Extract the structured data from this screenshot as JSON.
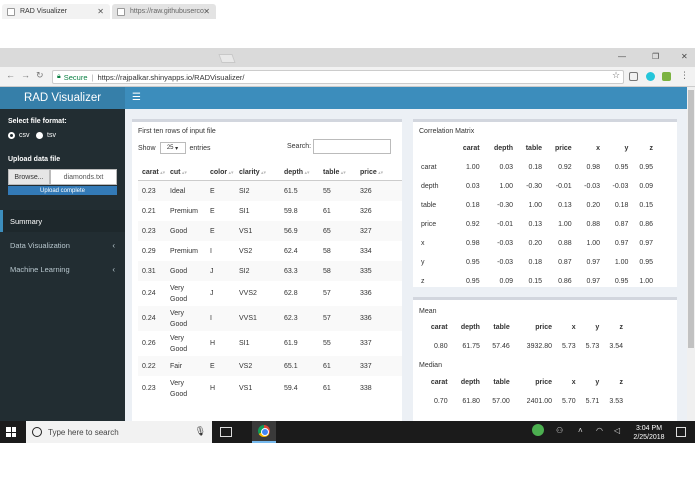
{
  "browser": {
    "tabs": [
      {
        "title": "RAD Visualizer",
        "active": true
      },
      {
        "title": "https://raw.githubuserco",
        "active": false
      }
    ],
    "secure_label": "Secure",
    "url": "https://rajpalkar.shinyapps.io/RADVisualizer/"
  },
  "app": {
    "title": "RAD Visualizer",
    "menu_icon": "hamburger-icon",
    "header_color": "#3c8dbc",
    "sidebar_color": "#222d32"
  },
  "sidebar": {
    "file_format_label": "Select file format:",
    "format_options": [
      "csv",
      "tsv"
    ],
    "selected_format": "csv",
    "upload_label": "Upload data file",
    "browse_label": "Browse...",
    "file_name": "diamonds.txt",
    "upload_status": "Upload complete",
    "upload_progress": 1.0,
    "menu": [
      {
        "label": "Summary",
        "active": true,
        "has_children": false
      },
      {
        "label": "Data Visualization",
        "active": false,
        "has_children": true
      },
      {
        "label": "Machine Learning",
        "active": false,
        "has_children": true
      }
    ]
  },
  "table_box": {
    "title": "First ten rows of input file",
    "show_label": "Show",
    "entries_value": "25",
    "entries_label": "entries",
    "search_label": "Search:",
    "columns": [
      "carat",
      "cut",
      "color",
      "clarity",
      "depth",
      "table",
      "price"
    ],
    "rows": [
      [
        "0.23",
        "Ideal",
        "E",
        "SI2",
        "61.5",
        "55",
        "326"
      ],
      [
        "0.21",
        "Premium",
        "E",
        "SI1",
        "59.8",
        "61",
        "326"
      ],
      [
        "0.23",
        "Good",
        "E",
        "VS1",
        "56.9",
        "65",
        "327"
      ],
      [
        "0.29",
        "Premium",
        "I",
        "VS2",
        "62.4",
        "58",
        "334"
      ],
      [
        "0.31",
        "Good",
        "J",
        "SI2",
        "63.3",
        "58",
        "335"
      ],
      [
        "0.24",
        "Very Good",
        "J",
        "VVS2",
        "62.8",
        "57",
        "336"
      ],
      [
        "0.24",
        "Very Good",
        "I",
        "VVS1",
        "62.3",
        "57",
        "336"
      ],
      [
        "0.26",
        "Very Good",
        "H",
        "SI1",
        "61.9",
        "55",
        "337"
      ],
      [
        "0.22",
        "Fair",
        "E",
        "VS2",
        "65.1",
        "61",
        "337"
      ],
      [
        "0.23",
        "Very Good",
        "H",
        "VS1",
        "59.4",
        "61",
        "338"
      ]
    ]
  },
  "correlation": {
    "title": "Correlation Matrix",
    "columns": [
      "carat",
      "depth",
      "table",
      "price",
      "x",
      "y",
      "z"
    ],
    "rows": [
      {
        "label": "carat",
        "values": [
          "1.00",
          "0.03",
          "0.18",
          "0.92",
          "0.98",
          "0.95",
          "0.95"
        ]
      },
      {
        "label": "depth",
        "values": [
          "0.03",
          "1.00",
          "-0.30",
          "-0.01",
          "-0.03",
          "-0.03",
          "0.09"
        ]
      },
      {
        "label": "table",
        "values": [
          "0.18",
          "-0.30",
          "1.00",
          "0.13",
          "0.20",
          "0.18",
          "0.15"
        ]
      },
      {
        "label": "price",
        "values": [
          "0.92",
          "-0.01",
          "0.13",
          "1.00",
          "0.88",
          "0.87",
          "0.86"
        ]
      },
      {
        "label": "x",
        "values": [
          "0.98",
          "-0.03",
          "0.20",
          "0.88",
          "1.00",
          "0.97",
          "0.97"
        ]
      },
      {
        "label": "y",
        "values": [
          "0.95",
          "-0.03",
          "0.18",
          "0.87",
          "0.97",
          "1.00",
          "0.95"
        ]
      },
      {
        "label": "z",
        "values": [
          "0.95",
          "0.09",
          "0.15",
          "0.86",
          "0.97",
          "0.95",
          "1.00"
        ]
      }
    ]
  },
  "stats": {
    "mean_title": "Mean",
    "median_title": "Median",
    "columns": [
      "carat",
      "depth",
      "table",
      "price",
      "x",
      "y",
      "z"
    ],
    "mean": [
      "0.80",
      "61.75",
      "57.46",
      "3932.80",
      "5.73",
      "5.73",
      "3.54"
    ],
    "median": [
      "0.70",
      "61.80",
      "57.00",
      "2401.00",
      "5.70",
      "5.71",
      "3.53"
    ]
  },
  "taskbar": {
    "search_placeholder": "Type here to search",
    "time": "3:04 PM",
    "date": "2/25/2018"
  }
}
